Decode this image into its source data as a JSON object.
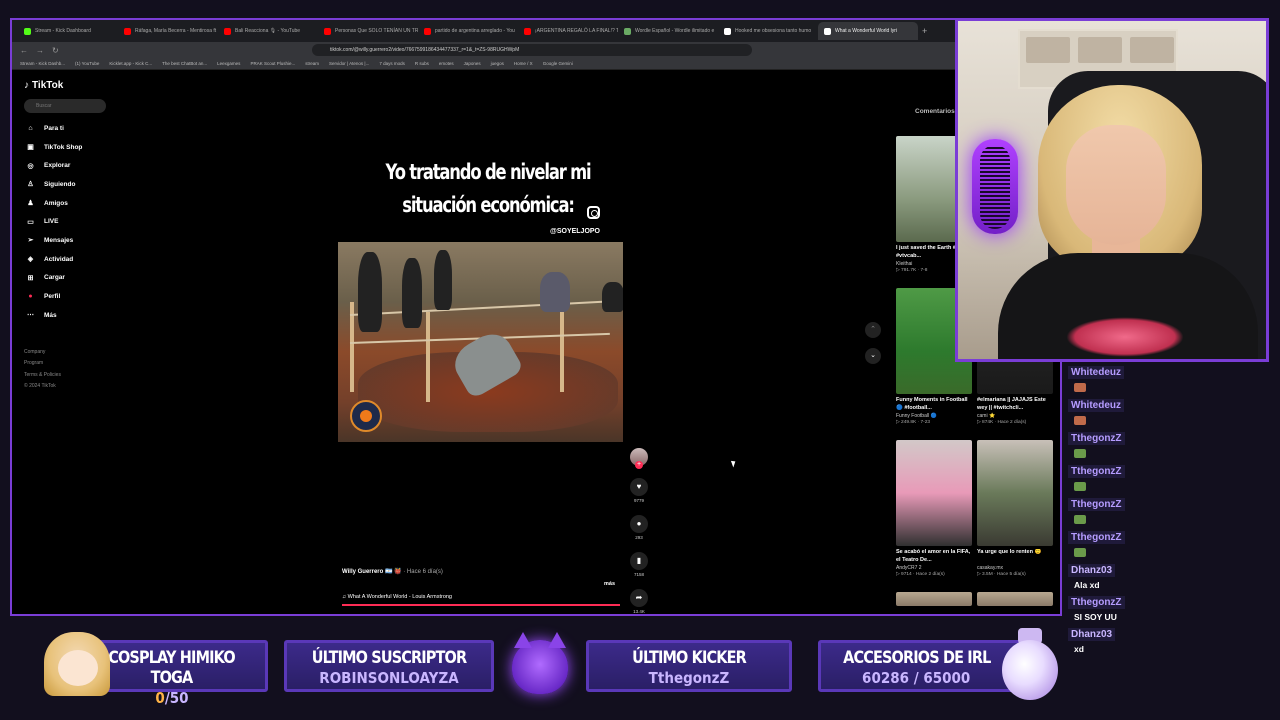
{
  "browser": {
    "tabs": [
      {
        "label": "Stream - Kick Dashboard",
        "color": "#53fc18"
      },
      {
        "label": "Ráfaga, María Becerra - Mentirosa ft",
        "color": "#ff0000"
      },
      {
        "label": "Bali Reacciona 🎙 - YouTube",
        "color": "#ff0000"
      },
      {
        "label": "Personas Que SOLO TENÍAN UN TRA",
        "color": "#ff0000"
      },
      {
        "label": "partido de argentina arreglado - You",
        "color": "#ff0000"
      },
      {
        "label": "¡ARGENTINA REGALÓ LA FINAL!? T!",
        "color": "#ff0000"
      },
      {
        "label": "Wordle Español - Wordle ilimitado e",
        "color": "#6aaa64"
      },
      {
        "label": "Hooked me obsesiona tanto humo",
        "color": "#ffffff"
      },
      {
        "label": "What a Wonderful World lyri",
        "color": "#ffffff",
        "active": true
      }
    ],
    "url": "tiktok.com/@willy.guerrero2/video/7667599186434477337_r=1&_t=ZS-98RUGHWpM",
    "bookmarks": [
      "Stream - Kick Dashb...",
      "(1) YouTube",
      "Kicklet.app - Kick C...",
      "The best ChatBot an...",
      "Leexgames",
      "PRAK Scout Plushie...",
      "stream",
      "Servidor | Atenos |...",
      "7 days mods",
      "R subs",
      "emotes",
      "Japones",
      "juegos",
      "Home / X",
      "Google Gemini"
    ]
  },
  "tiktok": {
    "logo": "TikTok",
    "search_placeholder": "Buscar",
    "nav": [
      {
        "label": "Para ti",
        "icon": "home-icon",
        "glyph": "⌂"
      },
      {
        "label": "TikTok Shop",
        "icon": "shop-icon",
        "glyph": "▣"
      },
      {
        "label": "Explorar",
        "icon": "explore-icon",
        "glyph": "◎"
      },
      {
        "label": "Siguiendo",
        "icon": "following-icon",
        "glyph": "♙"
      },
      {
        "label": "Amigos",
        "icon": "friends-icon",
        "glyph": "♟"
      },
      {
        "label": "LIVE",
        "icon": "live-icon",
        "glyph": "▭"
      },
      {
        "label": "Mensajes",
        "icon": "messages-icon",
        "glyph": "➢"
      },
      {
        "label": "Actividad",
        "icon": "activity-icon",
        "glyph": "◈"
      },
      {
        "label": "Cargar",
        "icon": "upload-icon",
        "glyph": "⊞"
      },
      {
        "label": "Perfil",
        "icon": "profile-icon",
        "glyph": "●"
      },
      {
        "label": "Más",
        "icon": "more-icon",
        "glyph": "⋯"
      }
    ],
    "legal": [
      "Company",
      "Program",
      "Terms & Policies",
      "© 2024 TikTok"
    ],
    "video": {
      "caption_line1": "Yo tratando de nivelar mi",
      "caption_line2": "situación económica:",
      "handle": "@SOYELJOPO",
      "author": "Willy Guerrero 🇦🇷 👹",
      "time": " · Hace 6 día(s)",
      "more": "más",
      "music": "♫  What A Wonderful World - Louis Armstrong",
      "likes": "9779",
      "comments": "293",
      "saves": "7158",
      "shares": "13.4K",
      "progress": 1.0
    },
    "comments_tab": "Comentarios",
    "cards": [
      {
        "title": "I just saved the Earth #meme #vtvcab...",
        "author": "Kleithai",
        "meta": "▷ 791.7K · 7-8"
      },
      {
        "title": "Funny Moments in Football 🔵 #football...",
        "author": "Funny Football 🔵",
        "meta": "▷ 249.8K · 7-23"
      },
      {
        "title": "#elmariana || JAJAJS Este wey || #twitchcli...",
        "author": "cami ⭐",
        "meta": "▷ 874K · Hace 2 día(s)"
      },
      {
        "title": "Se acabó el amor en la FIFA, el Teatro De...",
        "author": "AndyCR7 2",
        "meta": "▷ 9714 · Hace 2 día(s)"
      },
      {
        "title": "Ya urge que lo renten 🙂",
        "author": "casakay.mx",
        "meta": "▷ 3.5M · Hace 5 día(s)"
      }
    ]
  },
  "chat": [
    {
      "user": "Whitedeuz",
      "msg": ""
    },
    {
      "user": "Whitedeuz",
      "msg": ""
    },
    {
      "user": "TthegonzZ",
      "msg": ""
    },
    {
      "user": "TthegonzZ",
      "msg": ""
    },
    {
      "user": "TthegonzZ",
      "msg": ""
    },
    {
      "user": "TthegonzZ",
      "msg": ""
    },
    {
      "user": "Dhanz03",
      "msg": "Ala xd"
    },
    {
      "user": "TthegonzZ",
      "msg": "SI SOY UU"
    },
    {
      "user": "Dhanz03",
      "msg": "xd"
    }
  ],
  "overlay": {
    "goal_title": "COSPLAY HIMIKO TOGA",
    "goal_current": "0",
    "goal_total": "/50",
    "sub_title": "ÚLTIMO SUSCRIPTOR",
    "sub_name": "ROBINSONLOAYZA",
    "kicker_title": "ÚLTIMO KICKER",
    "kicker_name": "TthegonzZ",
    "irl_title": "ACCESORIOS DE IRL",
    "irl_value": "60286 / 65000"
  },
  "colors": {
    "accent": "#7a3dd6",
    "tiktok_red": "#fe2c55"
  }
}
